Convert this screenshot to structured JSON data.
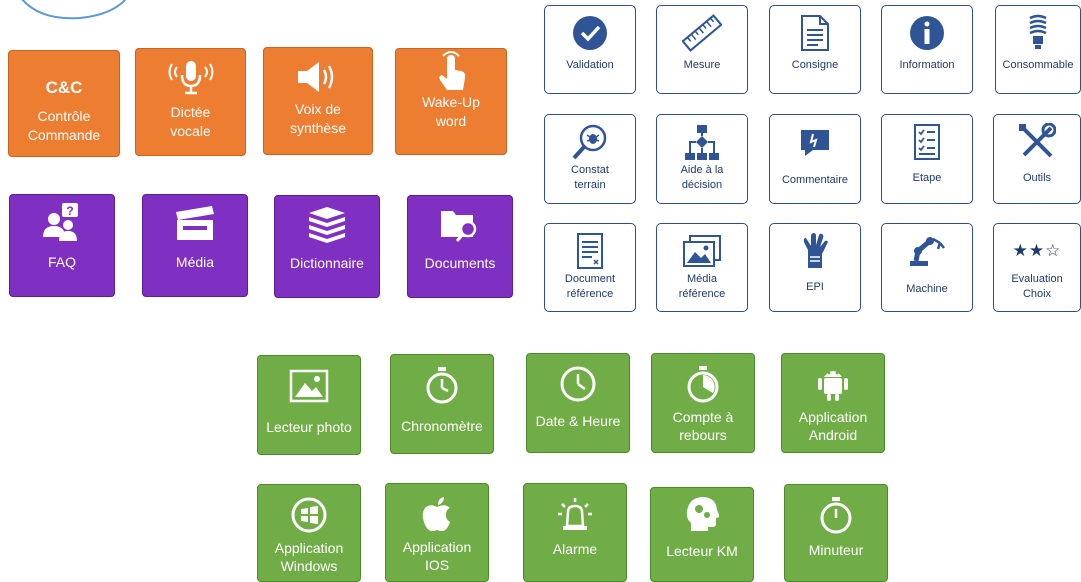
{
  "orange_tiles": {
    "cc": {
      "title": "C&C",
      "label1": "Contrôle",
      "label2": "Commande"
    },
    "dictee": {
      "label1": "Dictée",
      "label2": "vocale"
    },
    "voix": {
      "label1": "Voix de",
      "label2": "synthèse"
    },
    "wake": {
      "label1": "Wake-Up",
      "label2": "word"
    }
  },
  "purple_tiles": {
    "faq": "FAQ",
    "media": "Média",
    "dictionnaire": "Dictionnaire",
    "documents": "Documents"
  },
  "white_tiles": {
    "row1": [
      "Validation",
      "Mesure",
      "Consigne",
      "Information",
      "Consommable"
    ],
    "row2": [
      [
        "Constat",
        "terrain"
      ],
      [
        "Aide à la",
        "décision"
      ],
      [
        "Commentaire"
      ],
      [
        "Etape"
      ],
      [
        "Outils"
      ]
    ],
    "row3": [
      [
        "Document",
        "référence"
      ],
      [
        "Média",
        "référence"
      ],
      [
        "EPI"
      ],
      [
        "Machine"
      ],
      [
        "Evaluation",
        "Choix"
      ]
    ],
    "stars": "★★☆"
  },
  "green_tiles": {
    "row1": [
      [
        "Lecteur photo"
      ],
      [
        "Chronomètre"
      ],
      [
        "Date & Heure"
      ],
      [
        "Compte à",
        "rebours"
      ],
      [
        "Application",
        "Android"
      ]
    ],
    "row2": [
      [
        "Application",
        "Windows"
      ],
      [
        "Application",
        "IOS"
      ],
      [
        "Alarme"
      ],
      [
        "Lecteur KM"
      ],
      [
        "Minuteur"
      ]
    ]
  },
  "colors": {
    "orange": "#ed7d31",
    "purple": "#7f2fc2",
    "green": "#70ad47",
    "navy": "#1f3a6d",
    "blue_icon": "#2f5597"
  }
}
